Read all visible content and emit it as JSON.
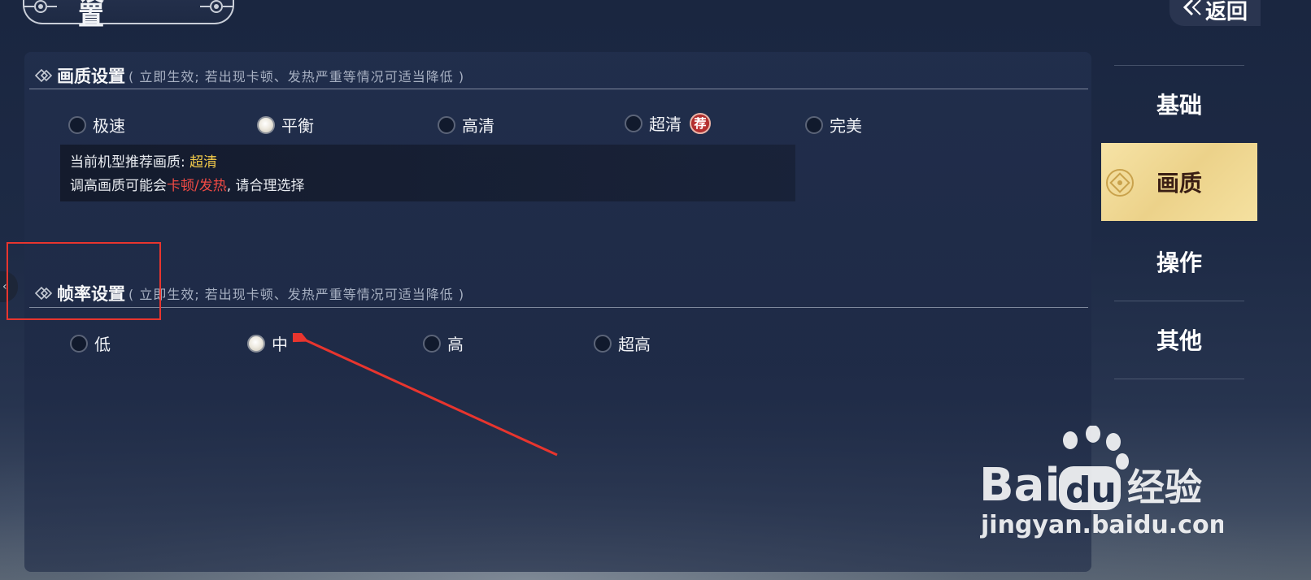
{
  "header": {
    "title": "设 置",
    "back_label": "返回"
  },
  "quality_section": {
    "title": "画质设置",
    "note": "( 立即生效; 若出现卡顿、发热严重等情况可适当降低 )",
    "options": [
      {
        "label": "极速",
        "selected": false
      },
      {
        "label": "平衡",
        "selected": true
      },
      {
        "label": "高清",
        "selected": false
      },
      {
        "label": "超清",
        "selected": false,
        "badge": "荐"
      },
      {
        "label": "完美",
        "selected": false
      }
    ],
    "tip": {
      "line1_prefix": "当前机型推荐画质: ",
      "line1_value": "超清",
      "line2_prefix": "调高画质可能会",
      "line2_warning": "卡顿/发热",
      "line2_suffix": ", 请合理选择"
    }
  },
  "framerate_section": {
    "title": "帧率设置",
    "note": "( 立即生效; 若出现卡顿、发热严重等情况可适当降低 )",
    "options": [
      {
        "label": "低",
        "selected": false
      },
      {
        "label": "中",
        "selected": true
      },
      {
        "label": "高",
        "selected": false
      },
      {
        "label": "超高",
        "selected": false
      }
    ]
  },
  "sidebar": {
    "items": [
      {
        "label": "基础",
        "active": false
      },
      {
        "label": "画质",
        "active": true
      },
      {
        "label": "操作",
        "active": false
      },
      {
        "label": "其他",
        "active": false
      }
    ]
  },
  "left_tab": {
    "glyph": "‹"
  },
  "watermark": {
    "brand": "Bai",
    "brand_du": "du",
    "cn": "经验",
    "url": "jingyan.baidu.com"
  },
  "colors": {
    "accent_gold": "#f1c94a",
    "warning_red": "#f04a44",
    "annotation_red": "#e8352e",
    "active_tab": "#f0d890"
  }
}
